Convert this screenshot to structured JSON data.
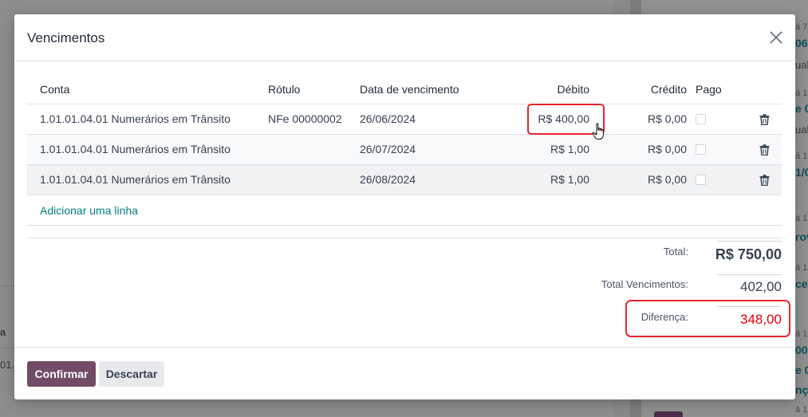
{
  "background": {
    "fragments": [
      "á 7",
      "06",
      "uali",
      "á 1",
      "e 0",
      "uali",
      "á 1",
      "1/0",
      "á 1",
      "rov",
      "á 1",
      "cel",
      "á 1",
      "a",
      "01.0",
      "002",
      "e 00",
      "nç",
      "á 1"
    ]
  },
  "modal": {
    "title": "Vencimentos",
    "close_label": "Fechar"
  },
  "table": {
    "headers": {
      "conta": "Conta",
      "rotulo": "Rótulo",
      "data": "Data de vencimento",
      "debito": "Débito",
      "credito": "Crédito",
      "pago": "Pago"
    },
    "rows": [
      {
        "conta": "1.01.01.04.01 Numerários em Trânsito",
        "rotulo": "NFe 00000002",
        "data": "26/06/2024",
        "debito": "R$ 400,00",
        "credito": "R$ 0,00",
        "pago": false
      },
      {
        "conta": "1.01.01.04.01 Numerários em Trânsito",
        "rotulo": "",
        "data": "26/07/2024",
        "debito": "R$ 1,00",
        "credito": "R$ 0,00",
        "pago": false
      },
      {
        "conta": "1.01.01.04.01 Numerários em Trânsito",
        "rotulo": "",
        "data": "26/08/2024",
        "debito": "R$ 1,00",
        "credito": "R$ 0,00",
        "pago": false
      }
    ],
    "add_line": "Adicionar uma linha"
  },
  "totals": {
    "total_label": "Total:",
    "total_value": "R$ 750,00",
    "vencimentos_label": "Total Vencimentos:",
    "vencimentos_value": "402,00",
    "diferenca_label": "Diferença:",
    "diferenca_value": "348,00"
  },
  "footer": {
    "confirm": "Confirmar",
    "discard": "Descartar"
  },
  "colors": {
    "primary": "#714b67",
    "link": "#017e84",
    "diff": "#e3000f",
    "highlight": "#e8262d"
  }
}
